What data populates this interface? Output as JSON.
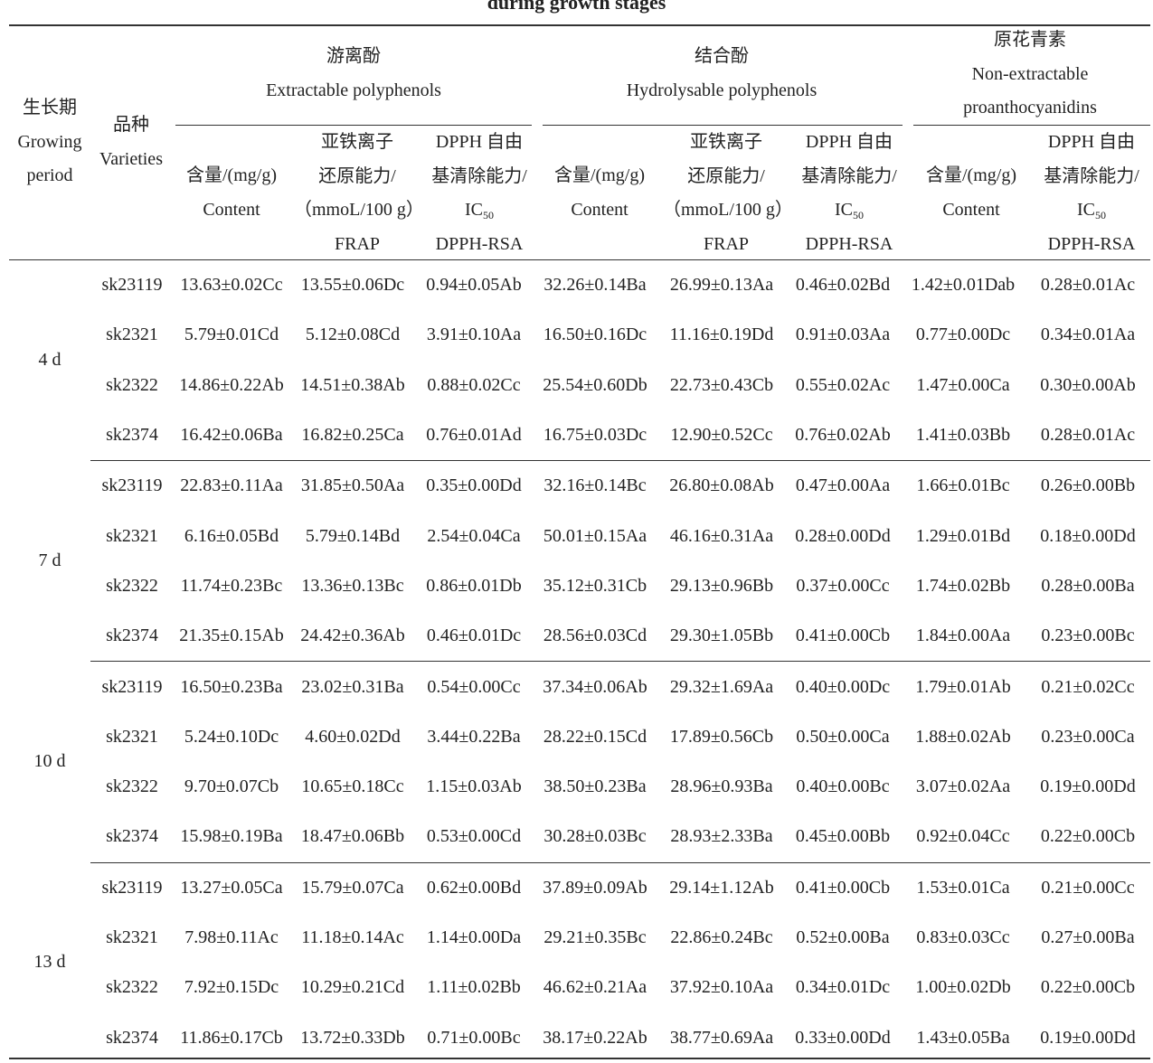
{
  "caption": "during growth stages",
  "headers": {
    "growing_period": [
      "生长期",
      "Growing",
      "period"
    ],
    "varieties": [
      "品种",
      "Varieties"
    ],
    "groups": [
      [
        "游离酚",
        "Extractable polyphenols"
      ],
      [
        "结合酚",
        "Hydrolysable polyphenols"
      ],
      [
        "原花青素",
        "Non-extractable",
        "proanthocyanidins"
      ]
    ],
    "content": [
      "含量/(mg/g)",
      "Content"
    ],
    "frap": [
      "亚铁离子",
      "还原能力/",
      "（mmoL/100 g）",
      "FRAP"
    ],
    "dpph": [
      "DPPH 自由",
      "基清除能力/",
      "IC",
      "50",
      "DPPH-RSA"
    ]
  },
  "groups": [
    {
      "period": "4 d",
      "rows": [
        [
          "sk23119",
          "13.63±0.02Cc",
          "13.55±0.06Dc",
          "0.94±0.05Ab",
          "32.26±0.14Ba",
          "26.99±0.13Aa",
          "0.46±0.02Bd",
          "1.42±0.01Dab",
          "0.28±0.01Ac"
        ],
        [
          "sk2321",
          "5.79±0.01Cd",
          "5.12±0.08Cd",
          "3.91±0.10Aa",
          "16.50±0.16Dc",
          "11.16±0.19Dd",
          "0.91±0.03Aa",
          "0.77±0.00Dc",
          "0.34±0.01Aa"
        ],
        [
          "sk2322",
          "14.86±0.22Ab",
          "14.51±0.38Ab",
          "0.88±0.02Cc",
          "25.54±0.60Db",
          "22.73±0.43Cb",
          "0.55±0.02Ac",
          "1.47±0.00Ca",
          "0.30±0.00Ab"
        ],
        [
          "sk2374",
          "16.42±0.06Ba",
          "16.82±0.25Ca",
          "0.76±0.01Ad",
          "16.75±0.03Dc",
          "12.90±0.52Cc",
          "0.76±0.02Ab",
          "1.41±0.03Bb",
          "0.28±0.01Ac"
        ]
      ]
    },
    {
      "period": "7 d",
      "rows": [
        [
          "sk23119",
          "22.83±0.11Aa",
          "31.85±0.50Aa",
          "0.35±0.00Dd",
          "32.16±0.14Bc",
          "26.80±0.08Ab",
          "0.47±0.00Aa",
          "1.66±0.01Bc",
          "0.26±0.00Bb"
        ],
        [
          "sk2321",
          "6.16±0.05Bd",
          "5.79±0.14Bd",
          "2.54±0.04Ca",
          "50.01±0.15Aa",
          "46.16±0.31Aa",
          "0.28±0.00Dd",
          "1.29±0.01Bd",
          "0.18±0.00Dd"
        ],
        [
          "sk2322",
          "11.74±0.23Bc",
          "13.36±0.13Bc",
          "0.86±0.01Db",
          "35.12±0.31Cb",
          "29.13±0.96Bb",
          "0.37±0.00Cc",
          "1.74±0.02Bb",
          "0.28±0.00Ba"
        ],
        [
          "sk2374",
          "21.35±0.15Ab",
          "24.42±0.36Ab",
          "0.46±0.01Dc",
          "28.56±0.03Cd",
          "29.30±1.05Bb",
          "0.41±0.00Cb",
          "1.84±0.00Aa",
          "0.23±0.00Bc"
        ]
      ]
    },
    {
      "period": "10 d",
      "rows": [
        [
          "sk23119",
          "16.50±0.23Ba",
          "23.02±0.31Ba",
          "0.54±0.00Cc",
          "37.34±0.06Ab",
          "29.32±1.69Aa",
          "0.40±0.00Dc",
          "1.79±0.01Ab",
          "0.21±0.02Cc"
        ],
        [
          "sk2321",
          "5.24±0.10Dc",
          "4.60±0.02Dd",
          "3.44±0.22Ba",
          "28.22±0.15Cd",
          "17.89±0.56Cb",
          "0.50±0.00Ca",
          "1.88±0.02Ab",
          "0.23±0.00Ca"
        ],
        [
          "sk2322",
          "9.70±0.07Cb",
          "10.65±0.18Cc",
          "1.15±0.03Ab",
          "38.50±0.23Ba",
          "28.96±0.93Ba",
          "0.40±0.00Bc",
          "3.07±0.02Aa",
          "0.19±0.00Dd"
        ],
        [
          "sk2374",
          "15.98±0.19Ba",
          "18.47±0.06Bb",
          "0.53±0.00Cd",
          "30.28±0.03Bc",
          "28.93±2.33Ba",
          "0.45±0.00Bb",
          "0.92±0.04Cc",
          "0.22±0.00Cb"
        ]
      ]
    },
    {
      "period": "13 d",
      "rows": [
        [
          "sk23119",
          "13.27±0.05Ca",
          "15.79±0.07Ca",
          "0.62±0.00Bd",
          "37.89±0.09Ab",
          "29.14±1.12Ab",
          "0.41±0.00Cb",
          "1.53±0.01Ca",
          "0.21±0.00Cc"
        ],
        [
          "sk2321",
          "7.98±0.11Ac",
          "11.18±0.14Ac",
          "1.14±0.00Da",
          "29.21±0.35Bc",
          "22.86±0.24Bc",
          "0.52±0.00Ba",
          "0.83±0.03Cc",
          "0.27±0.00Ba"
        ],
        [
          "sk2322",
          "7.92±0.15Dc",
          "10.29±0.21Cd",
          "1.11±0.02Bb",
          "46.62±0.21Aa",
          "37.92±0.10Aa",
          "0.34±0.01Dc",
          "1.00±0.02Db",
          "0.22±0.00Cb"
        ],
        [
          "sk2374",
          "11.86±0.17Cb",
          "13.72±0.33Db",
          "0.71±0.00Bc",
          "38.17±0.22Ab",
          "38.77±0.69Aa",
          "0.33±0.00Dd",
          "1.43±0.05Ba",
          "0.19±0.00Dd"
        ]
      ]
    }
  ]
}
